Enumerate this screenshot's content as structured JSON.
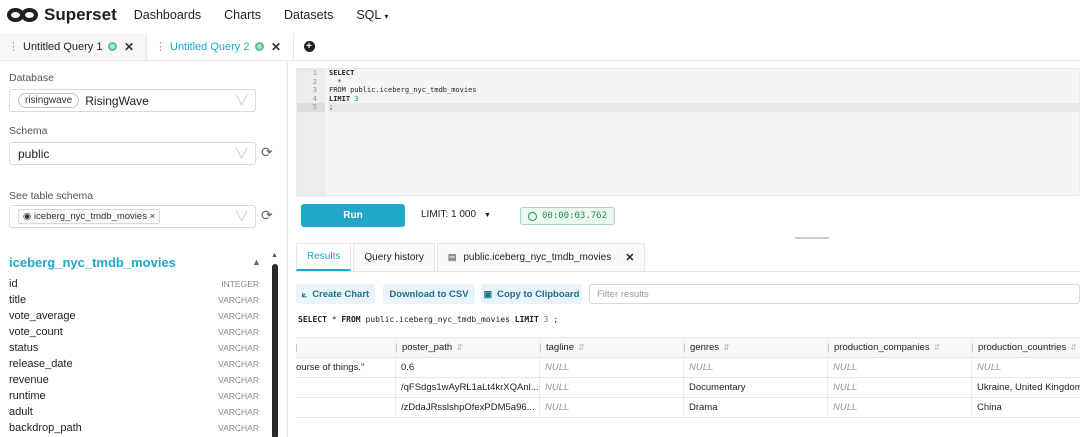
{
  "nav": {
    "brand": "Superset",
    "items": [
      "Dashboards",
      "Charts",
      "Datasets",
      "SQL"
    ],
    "sql_caret": "▾"
  },
  "query_tabs": [
    {
      "label": "Untitled Query 1",
      "active": false
    },
    {
      "label": "Untitled Query 2",
      "active": true
    }
  ],
  "left": {
    "database_label": "Database",
    "database_badge": "risingwave",
    "database_value": "RisingWave",
    "schema_label": "Schema",
    "schema_value": "public",
    "table_label": "See table schema",
    "table_tag": "iceberg_nyc_tmdb_movies",
    "table_title": "iceberg_nyc_tmdb_movies",
    "columns": [
      {
        "name": "id",
        "type": "INTEGER"
      },
      {
        "name": "title",
        "type": "VARCHAR"
      },
      {
        "name": "vote_average",
        "type": "VARCHAR"
      },
      {
        "name": "vote_count",
        "type": "VARCHAR"
      },
      {
        "name": "status",
        "type": "VARCHAR"
      },
      {
        "name": "release_date",
        "type": "VARCHAR"
      },
      {
        "name": "revenue",
        "type": "VARCHAR"
      },
      {
        "name": "runtime",
        "type": "VARCHAR"
      },
      {
        "name": "adult",
        "type": "VARCHAR"
      },
      {
        "name": "backdrop_path",
        "type": "VARCHAR"
      }
    ]
  },
  "editor": {
    "line_numbers": [
      "1",
      "2",
      "3",
      "4",
      "5"
    ],
    "lines": [
      "SELECT",
      "  *",
      "FROM public.iceberg_nyc_tmdb_movies",
      "LIMIT 3",
      ";"
    ]
  },
  "controls": {
    "run_label": "Run",
    "limit_label": "LIMIT: 1 000",
    "timer": "00:00:03.762"
  },
  "result_tabs": {
    "results": "Results",
    "history": "Query history",
    "table": "public.iceberg_nyc_tmdb_movies"
  },
  "actions": {
    "create_chart": "Create Chart",
    "download_csv": "Download to CSV",
    "copy_clipboard": "Copy to Clipboard",
    "filter_placeholder": "Filter results"
  },
  "executed_sql": {
    "select": "SELECT",
    "star": " * ",
    "from": "FROM",
    "rest": " public.iceberg_nyc_tmdb_movies ",
    "limit": "LIMIT",
    "num": "3",
    "end": " ;"
  },
  "results": {
    "columns": [
      "",
      "poster_path",
      "tagline",
      "genres",
      "production_companies",
      "production_countries"
    ],
    "rows": [
      [
        "ourse of things.\"",
        "0.6",
        "NULL",
        "NULL",
        "NULL",
        "NULL"
      ],
      [
        "",
        "/qFSdgs1wAyRL1aLt4krXQAnl...",
        "NULL",
        "Documentary",
        "NULL",
        "Ukraine, United Kingdom"
      ],
      [
        "",
        "/zDdaJRsslshpOfexPDM5a96...",
        "NULL",
        "Drama",
        "NULL",
        "China"
      ]
    ]
  }
}
